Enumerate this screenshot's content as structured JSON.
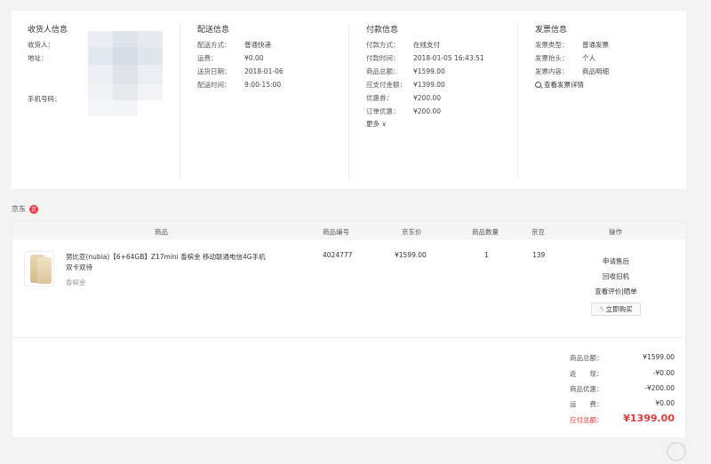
{
  "consignee": {
    "title": "收货人信息",
    "name_label": "收货人：",
    "address_label": "地址：",
    "phone_label": "手机号码："
  },
  "delivery": {
    "title": "配送信息",
    "rows": [
      {
        "k": "配送方式：",
        "v": "普通快递"
      },
      {
        "k": "运费：",
        "v": "¥0.00"
      },
      {
        "k": "送货日期：",
        "v": "2018-01-06"
      },
      {
        "k": "配送时间：",
        "v": "9:00-15:00"
      }
    ]
  },
  "payment": {
    "title": "付款信息",
    "rows": [
      {
        "k": "付款方式：",
        "v": "在线支付"
      },
      {
        "k": "付款时间：",
        "v": "2018-01-05 16:43:51"
      },
      {
        "k": "商品总额：",
        "v": "¥1599.00"
      },
      {
        "k": "应支付金额：",
        "v": "¥1399.00"
      },
      {
        "k": "优惠券：",
        "v": "¥200.00"
      },
      {
        "k": "订单优惠：",
        "v": "¥200.00"
      }
    ],
    "more": "更多 ∨"
  },
  "invoice": {
    "title": "发票信息",
    "rows": [
      {
        "k": "发票类型：",
        "v": "普通发票"
      },
      {
        "k": "发票抬头：",
        "v": "个人"
      },
      {
        "k": "发票内容：",
        "v": "商品明细"
      }
    ],
    "view_link": "查看发票详情"
  },
  "shop": {
    "name": "京东",
    "badge": "京"
  },
  "table": {
    "headers": {
      "product": "商品",
      "sku": "商品编号",
      "price": "京东价",
      "qty": "商品数量",
      "beans": "京豆",
      "ops": "操作"
    },
    "item": {
      "name": "努比亚(nubia)【6+64GB】Z17mini 香槟金 移动联通电信4G手机 双卡双待",
      "color": "香槟金",
      "sku": "4024777",
      "price": "¥1599.00",
      "qty": "1",
      "beans": "139"
    },
    "ops": {
      "after_sale": "申请售后",
      "recycle": "回收旧机",
      "review": "查看评价|晒单",
      "buy_now": "立即购买"
    }
  },
  "totals": {
    "rows": [
      {
        "k": "商品总额：",
        "v": "¥1599.00"
      },
      {
        "k": "返　　现：",
        "v": "-¥0.00"
      },
      {
        "k": "商品优惠：",
        "v": "-¥200.00"
      },
      {
        "k": "运　　费：",
        "v": "¥0.00"
      }
    ],
    "pay_label": "应付总额：",
    "pay_value": "¥1399.00"
  },
  "colors": {
    "accent": "#e4393c",
    "panel": "#ffffff",
    "bg": "#f3f3f3"
  },
  "icons": {
    "search": "magnifier-icon",
    "bolt": "lightning-icon"
  }
}
